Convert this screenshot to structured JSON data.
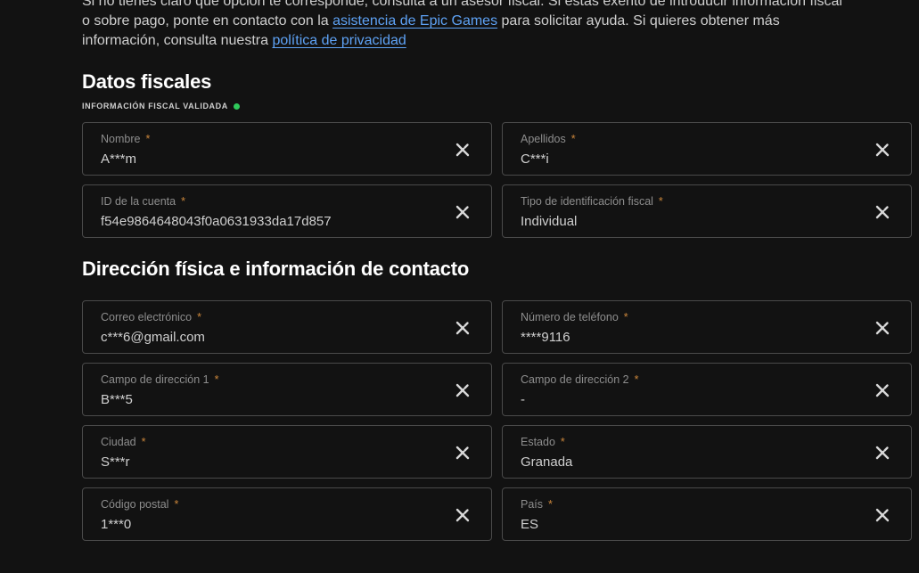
{
  "intro": {
    "line1": "Si no tienes claro qué opción te corresponde, consulta a un asesor fiscal. Si estás exento de introducir información fiscal",
    "line2_before": "o sobre pago, ponte en contacto con la ",
    "line2_link": "asistencia de Epic Games",
    "line2_after": " para solicitar ayuda. Si quieres obtener más",
    "line3_before": "información, consulta nuestra ",
    "line3_link": "política de privacidad"
  },
  "fiscal": {
    "title": "Datos fiscales",
    "status": "INFORMACIÓN FISCAL VALIDADA",
    "status_color": "#2fc95b",
    "fields": [
      {
        "label": "Nombre",
        "value": "A***m"
      },
      {
        "label": "Apellidos",
        "value": "C***i"
      },
      {
        "label": "ID de la cuenta",
        "value": "f54e9864648043f0a0631933da17d857"
      },
      {
        "label": "Tipo de identificación fiscal",
        "value": "Individual"
      }
    ]
  },
  "address": {
    "title": "Dirección física e información de contacto",
    "fields": [
      {
        "label": "Correo electrónico",
        "value": "c***6@gmail.com"
      },
      {
        "label": "Número de teléfono",
        "value": "****9116"
      },
      {
        "label": "Campo de dirección 1",
        "value": "B***5"
      },
      {
        "label": "Campo de dirección 2",
        "value": "-"
      },
      {
        "label": "Ciudad",
        "value": "S***r"
      },
      {
        "label": "Estado",
        "value": "Granada"
      },
      {
        "label": "Código postal",
        "value": "1***0"
      },
      {
        "label": "País",
        "value": "ES"
      }
    ]
  },
  "required_mark": "*",
  "colors": {
    "background": "#121212",
    "link": "#5ea2f5",
    "required": "#c9853b",
    "border": "#4a4a4a"
  },
  "icons": {
    "edit": "edit-icon"
  }
}
